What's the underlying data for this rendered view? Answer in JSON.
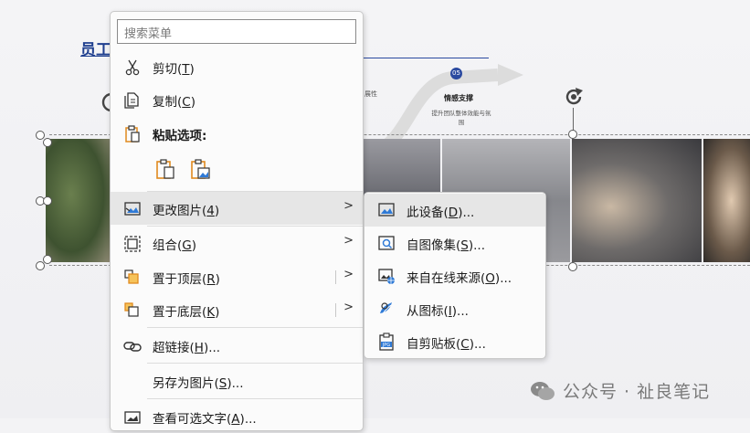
{
  "slide": {
    "title": "员工",
    "step_number": "05",
    "step_title": "情感支撑",
    "step_desc": "提升团队整体效能与氛围",
    "partial_text": "展性"
  },
  "watermark": {
    "text": "公众号 · 祉良笔记"
  },
  "context_menu": {
    "search_placeholder": "搜索菜单",
    "items": {
      "cut": {
        "label": "剪切",
        "key": "T"
      },
      "copy": {
        "label": "复制",
        "key": "C"
      },
      "paste_options": {
        "label": "粘贴选项:"
      },
      "change_picture": {
        "label": "更改图片",
        "key": "4"
      },
      "group": {
        "label": "组合",
        "key": "G"
      },
      "bring_front": {
        "label": "置于顶层",
        "key": "R"
      },
      "send_back": {
        "label": "置于底层",
        "key": "K"
      },
      "hyperlink": {
        "label": "超链接",
        "key": "H",
        "suffix": "..."
      },
      "save_as_picture": {
        "label": "另存为图片",
        "key": "S",
        "suffix": "..."
      },
      "alt_text": {
        "label": "查看可选文字",
        "key": "A",
        "suffix": "..."
      }
    }
  },
  "submenu": {
    "items": {
      "this_device": {
        "label": "此设备",
        "key": "D",
        "suffix": "..."
      },
      "from_stock": {
        "label": "自图像集",
        "key": "S",
        "suffix": "..."
      },
      "online": {
        "label": "来自在线来源",
        "key": "O",
        "suffix": "..."
      },
      "from_icons": {
        "label": "从图标",
        "key": "I",
        "suffix": "..."
      },
      "from_clipboard": {
        "label": "自剪贴板",
        "key": "C",
        "suffix": "..."
      }
    }
  },
  "colors": {
    "accent": "#1f3f8f",
    "menu_hover": "#e6e6e6",
    "paste_icon": "#e08a1e"
  }
}
